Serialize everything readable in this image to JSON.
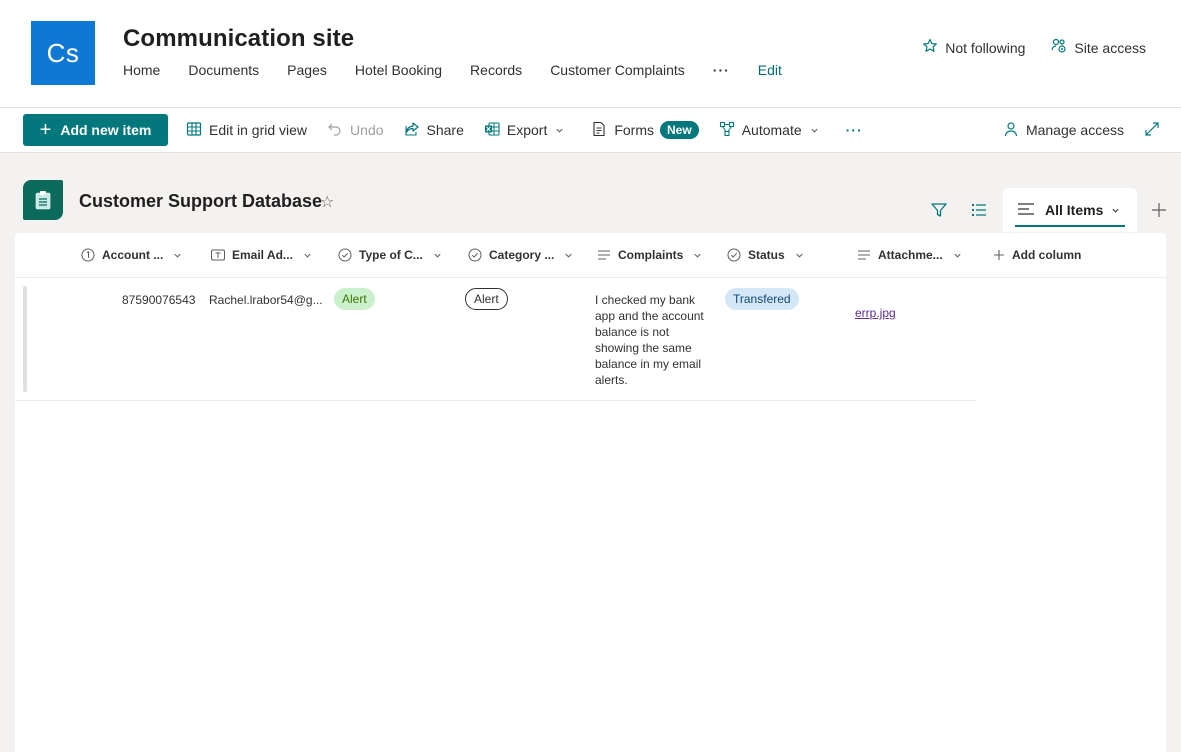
{
  "site": {
    "logo_text": "Cs",
    "title": "Communication site",
    "nav": [
      "Home",
      "Documents",
      "Pages",
      "Hotel Booking",
      "Records",
      "Customer Complaints"
    ],
    "nav_more": "···",
    "nav_edit": "Edit",
    "follow_label": "Not following",
    "site_access_label": "Site access"
  },
  "commands": {
    "add_new_item": "Add new item",
    "edit_grid": "Edit in grid view",
    "undo": "Undo",
    "share": "Share",
    "export": "Export",
    "forms": "Forms",
    "forms_badge": "New",
    "automate": "Automate",
    "more": "···",
    "manage_access": "Manage access"
  },
  "list": {
    "title": "Customer Support Database",
    "view_name": "All Items",
    "columns": [
      "Account ...",
      "Email Ad...",
      "Type of C...",
      "Category ...",
      "Complaints",
      "Status",
      "Attachme..."
    ],
    "add_column": "Add column",
    "rows": [
      {
        "account": "87590076543",
        "email": "Rachel.lrabor54@g...",
        "type": "Alert",
        "category": "Alert",
        "complaints": "I checked my bank app and the account balance is not showing the same balance in my email alerts.",
        "status": "Transfered",
        "attachment": "errp.jpg"
      }
    ]
  },
  "colors": {
    "brand": "#03787c",
    "logo_bg": "#0f78d4",
    "list_icon": "#0b6a5c",
    "pill_green": "#caf0cc",
    "pill_blue": "#d4e7f6"
  }
}
